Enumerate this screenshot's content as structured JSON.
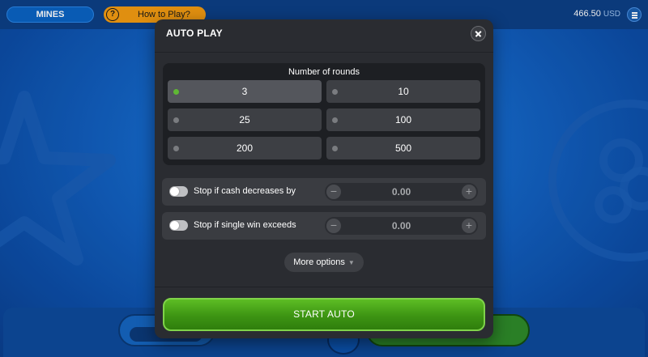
{
  "topbar": {
    "game_label": "MINES",
    "help_label": "How to Play?",
    "help_icon_glyph": "?",
    "balance_amount": "466.50",
    "balance_currency": "USD"
  },
  "modal": {
    "title": "AUTO PLAY",
    "rounds_title": "Number of rounds",
    "rounds": [
      {
        "label": "3",
        "selected": true
      },
      {
        "label": "10",
        "selected": false
      },
      {
        "label": "25",
        "selected": false
      },
      {
        "label": "100",
        "selected": false
      },
      {
        "label": "200",
        "selected": false
      },
      {
        "label": "500",
        "selected": false
      }
    ],
    "stop_conditions": [
      {
        "label": "Stop if cash decreases by",
        "value": "0.00",
        "enabled": false
      },
      {
        "label": "Stop if single win exceeds",
        "value": "0.00",
        "enabled": false
      }
    ],
    "stepper_minus": "−",
    "stepper_plus": "+",
    "more_options_label": "More options",
    "start_label": "START AUTO"
  },
  "colors": {
    "accent_green": "#3d9413",
    "selected_dot": "#5fb834",
    "help_pill": "#f39c12",
    "modal_bg": "#2a2c31"
  }
}
